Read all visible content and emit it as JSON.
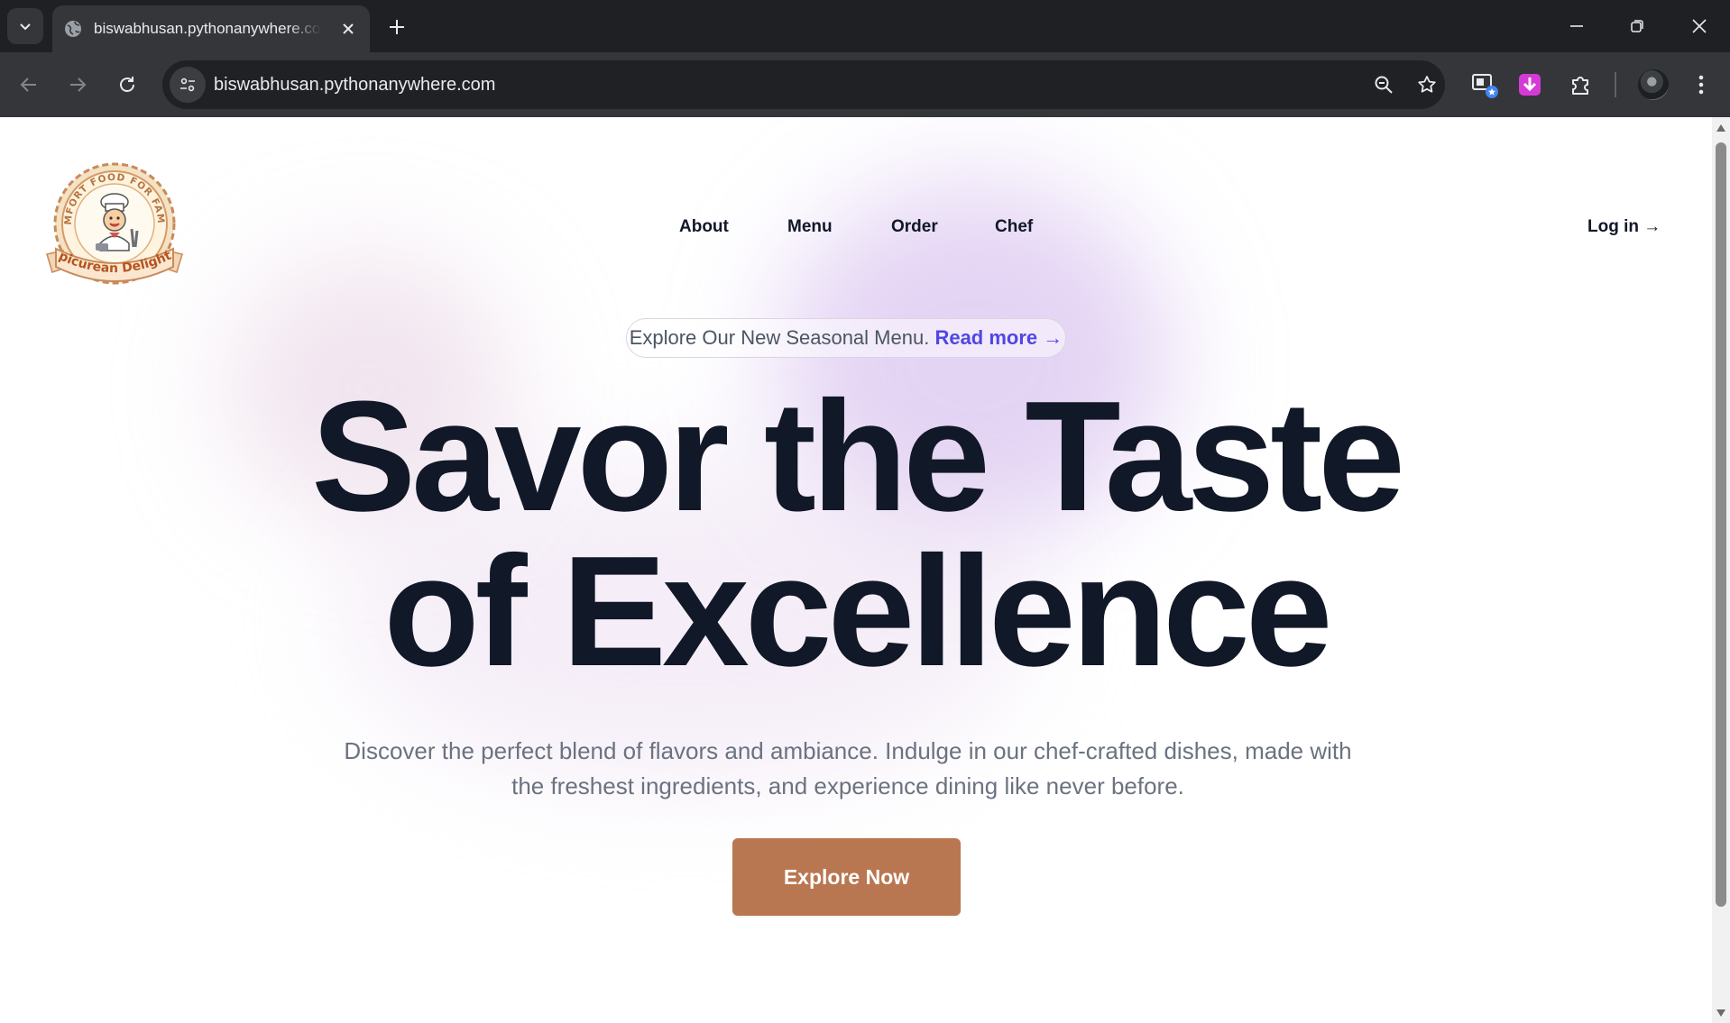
{
  "browser": {
    "tab_title": "biswabhusan.pythonanywhere.com",
    "url": "biswabhusan.pythonanywhere.com",
    "icons": [
      "tab-search-icon",
      "globe-icon",
      "close-icon",
      "plus-icon",
      "minimize-icon",
      "restore-icon",
      "window-close-icon",
      "back-icon",
      "forward-icon",
      "reload-icon",
      "site-settings-icon",
      "zoom-icon",
      "bookmark-star-icon",
      "tab-groups-icon",
      "download-extension-icon",
      "puzzle-icon",
      "profile-avatar",
      "menu-dots-icon"
    ]
  },
  "site": {
    "logo": {
      "arc_text": "COMFORT FOOD FOR FAMILY",
      "ribbon_text": "Epicurean Delights"
    },
    "nav": [
      "About",
      "Menu",
      "Order",
      "Chef"
    ],
    "login": "Log in →",
    "announcement": {
      "text": "Explore Our New Seasonal Menu.",
      "link": "Read more →"
    },
    "hero": {
      "title_line1": "Savor the Taste",
      "title_line2": "of Excellence",
      "subtitle_line1": "Discover the perfect blend of flavors and ambiance. Indulge in our chef-crafted dishes, made with",
      "subtitle_line2": "the freshest ingredients, and experience dining like never before.",
      "cta": "Explore Now"
    },
    "colors": {
      "cta": "#b97751",
      "link": "#4f46e5",
      "heading": "#111827"
    }
  }
}
